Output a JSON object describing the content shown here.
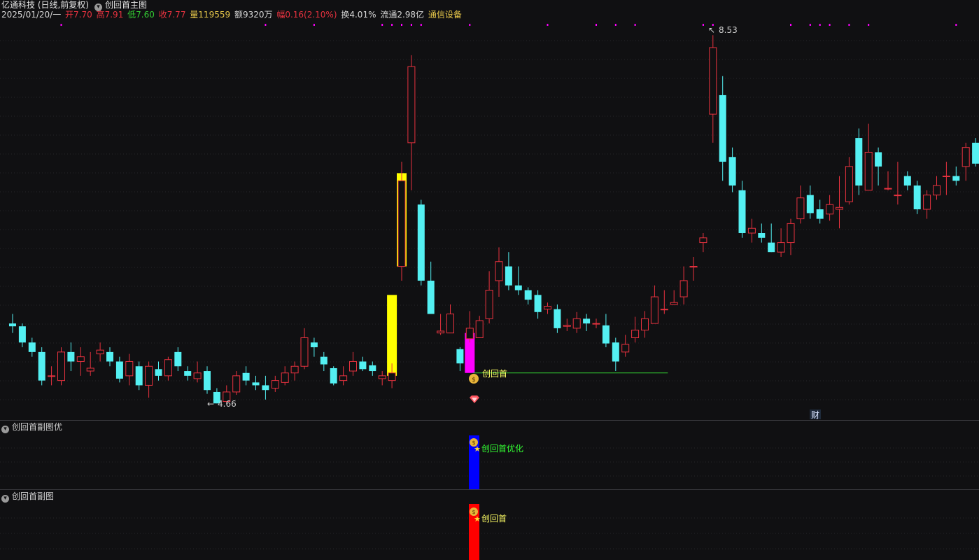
{
  "header": {
    "title": "亿通科技 (日线,前复权)",
    "indicator_name": "创回首主图",
    "date": "2025/01/20/一",
    "open_label": "开7.70",
    "high_label": "高7.91",
    "low_label": "低7.60",
    "close_label": "收7.77",
    "volume_label": "量119559",
    "amount_label": "额9320万",
    "change_label": "幅0.16(2.10%)",
    "turnover_label": "换4.01%",
    "float_label": "流通2.98亿",
    "sector_label": "通信设备"
  },
  "colors": {
    "up": "#e8323f",
    "down": "#54f0f2",
    "yellow": "#ffff00",
    "magenta": "#ff00ff",
    "blue": "#0000ff",
    "red_bar": "#ff0000",
    "signal_text": "#ffff66",
    "signal_text_green": "#33ff33",
    "support_line": "#33cc33",
    "grid": "#26262a"
  },
  "main_panel": {
    "max_label": "8.53",
    "min_label": "4.66",
    "signal_label": "创回首",
    "finance_badge": "财"
  },
  "sub_panel_1": {
    "label": "创回首副图优",
    "signal_label": "创回首优化"
  },
  "sub_panel_2": {
    "label": "创回首副图",
    "signal_label": "创回首"
  },
  "chart_data": {
    "type": "candlestick",
    "price_range": [
      4.5,
      8.65
    ],
    "candles": [
      [
        5.5,
        5.47,
        5.6,
        5.4
      ],
      [
        5.47,
        5.3,
        5.5,
        5.25
      ],
      [
        5.3,
        5.2,
        5.35,
        5.15
      ],
      [
        5.2,
        4.9,
        5.25,
        4.85
      ],
      [
        4.95,
        4.95,
        5.05,
        4.85
      ],
      [
        4.9,
        5.2,
        5.25,
        4.85
      ],
      [
        5.2,
        5.1,
        5.3,
        5.0
      ],
      [
        5.1,
        5.15,
        5.25,
        4.95
      ],
      [
        5.0,
        5.03,
        5.2,
        4.95
      ],
      [
        5.18,
        5.22,
        5.3,
        5.1
      ],
      [
        5.2,
        5.1,
        5.25,
        5.05
      ],
      [
        5.1,
        4.92,
        5.15,
        4.88
      ],
      [
        4.95,
        5.1,
        5.18,
        4.85
      ],
      [
        5.05,
        4.85,
        5.1,
        4.8
      ],
      [
        4.85,
        5.05,
        5.1,
        4.72
      ],
      [
        5.02,
        4.95,
        5.1,
        4.9
      ],
      [
        4.95,
        5.12,
        5.15,
        4.9
      ],
      [
        5.2,
        5.05,
        5.25,
        5.0
      ],
      [
        5.0,
        4.95,
        5.05,
        4.9
      ],
      [
        4.92,
        4.98,
        5.1,
        4.88
      ],
      [
        5.0,
        4.8,
        5.05,
        4.76
      ],
      [
        4.78,
        4.66,
        4.82,
        4.66
      ],
      [
        4.68,
        4.78,
        4.85,
        4.66
      ],
      [
        4.78,
        4.95,
        5.0,
        4.75
      ],
      [
        4.98,
        4.9,
        5.05,
        4.85
      ],
      [
        4.88,
        4.85,
        4.95,
        4.8
      ],
      [
        4.85,
        4.8,
        4.95,
        4.7
      ],
      [
        4.82,
        4.9,
        4.95,
        4.78
      ],
      [
        4.88,
        4.98,
        5.05,
        4.85
      ],
      [
        4.98,
        5.05,
        5.1,
        4.9
      ],
      [
        5.05,
        5.35,
        5.45,
        5.02
      ],
      [
        5.3,
        5.25,
        5.35,
        5.15
      ],
      [
        5.15,
        5.07,
        5.2,
        5.0
      ],
      [
        5.03,
        4.87,
        5.05,
        4.85
      ],
      [
        4.9,
        4.95,
        5.05,
        4.85
      ],
      [
        5.0,
        5.1,
        5.2,
        4.95
      ],
      [
        5.1,
        5.02,
        5.15,
        5.0
      ],
      [
        5.06,
        5.0,
        5.1,
        4.95
      ],
      [
        4.92,
        4.95,
        5.0,
        4.85
      ],
      [
        4.9,
        4.98,
        5.08,
        4.82
      ],
      [
        6.1,
        7.0,
        7.2,
        5.95
      ],
      [
        7.4,
        8.2,
        8.32,
        6.9
      ],
      [
        6.75,
        5.95,
        6.8,
        5.9
      ],
      [
        5.95,
        5.6,
        6.15,
        5.6
      ],
      [
        5.4,
        5.42,
        5.6,
        5.38
      ],
      [
        5.4,
        5.6,
        5.7,
        5.4
      ],
      [
        5.23,
        5.08,
        5.25,
        5.0
      ],
      [
        5.34,
        5.45,
        5.63,
        5.3
      ],
      [
        5.35,
        5.53,
        5.58,
        5.35
      ],
      [
        5.55,
        5.85,
        6.05,
        5.5
      ],
      [
        5.95,
        6.15,
        6.3,
        5.78
      ],
      [
        6.1,
        5.9,
        6.25,
        5.85
      ],
      [
        5.9,
        5.85,
        6.1,
        5.8
      ],
      [
        5.85,
        5.75,
        5.88,
        5.7
      ],
      [
        5.8,
        5.62,
        5.85,
        5.55
      ],
      [
        5.65,
        5.68,
        5.72,
        5.6
      ],
      [
        5.65,
        5.45,
        5.7,
        5.4
      ],
      [
        5.47,
        5.48,
        5.55,
        5.42
      ],
      [
        5.45,
        5.55,
        5.62,
        5.4
      ],
      [
        5.55,
        5.5,
        5.6,
        5.42
      ],
      [
        5.5,
        5.5,
        5.55,
        5.45
      ],
      [
        5.48,
        5.29,
        5.6,
        5.25
      ],
      [
        5.3,
        5.1,
        5.35,
        5.0
      ],
      [
        5.2,
        5.28,
        5.38,
        5.15
      ],
      [
        5.35,
        5.43,
        5.57,
        5.3
      ],
      [
        5.43,
        5.55,
        5.63,
        5.35
      ],
      [
        5.5,
        5.78,
        5.9,
        5.5
      ],
      [
        5.65,
        5.65,
        5.85,
        5.6
      ],
      [
        5.7,
        5.72,
        5.85,
        5.7
      ],
      [
        5.78,
        5.95,
        6.1,
        5.7
      ],
      [
        6.1,
        6.1,
        6.2,
        5.95
      ],
      [
        6.35,
        6.4,
        6.45,
        6.25
      ],
      [
        7.7,
        8.4,
        8.53,
        7.4
      ],
      [
        7.9,
        7.2,
        8.1,
        7.0
      ],
      [
        7.25,
        6.95,
        7.35,
        6.88
      ],
      [
        6.9,
        6.45,
        7.0,
        6.4
      ],
      [
        6.45,
        6.5,
        6.6,
        6.35
      ],
      [
        6.45,
        6.4,
        6.55,
        6.35
      ],
      [
        6.35,
        6.25,
        6.55,
        6.25
      ],
      [
        6.25,
        6.35,
        6.5,
        6.2
      ],
      [
        6.35,
        6.55,
        6.6,
        6.22
      ],
      [
        6.6,
        6.82,
        6.95,
        6.55
      ],
      [
        6.85,
        6.66,
        6.95,
        6.6
      ],
      [
        6.7,
        6.6,
        6.8,
        6.55
      ],
      [
        6.65,
        6.75,
        6.85,
        6.58
      ],
      [
        6.7,
        6.72,
        7.05,
        6.5
      ],
      [
        6.78,
        7.15,
        7.25,
        6.75
      ],
      [
        7.45,
        6.95,
        7.55,
        6.85
      ],
      [
        6.9,
        7.3,
        7.6,
        6.9
      ],
      [
        7.3,
        7.15,
        7.35,
        6.95
      ],
      [
        6.92,
        6.92,
        7.1,
        6.9
      ],
      [
        6.85,
        6.85,
        7.2,
        6.75
      ],
      [
        7.05,
        6.95,
        7.1,
        6.9
      ],
      [
        6.95,
        6.7,
        7.0,
        6.65
      ],
      [
        6.7,
        6.85,
        6.9,
        6.6
      ],
      [
        6.85,
        6.95,
        7.05,
        6.8
      ],
      [
        7.05,
        7.05,
        7.2,
        6.85
      ],
      [
        7.05,
        7.0,
        7.15,
        6.95
      ],
      [
        7.15,
        7.35,
        7.4,
        7.0
      ],
      [
        7.4,
        7.18,
        7.45,
        7.15
      ],
      [
        7.45,
        7.22,
        7.5,
        7.05
      ],
      [
        7.2,
        7.15,
        7.55,
        7.1
      ]
    ],
    "yellow_bars": [
      {
        "index": 39,
        "top": 5.8,
        "bottom": 4.95
      },
      {
        "index": 40,
        "top": 7.08,
        "bottom": 6.1
      }
    ],
    "magenta_bar": {
      "index": 47,
      "top": 5.4,
      "bottom": 4.98
    },
    "support_level": {
      "price": 4.98,
      "from_index": 47,
      "to_index": 67
    },
    "max_point": {
      "index": 71,
      "price": 8.53
    },
    "min_point": {
      "index": 21,
      "price": 4.66
    },
    "signal_index": 47
  }
}
